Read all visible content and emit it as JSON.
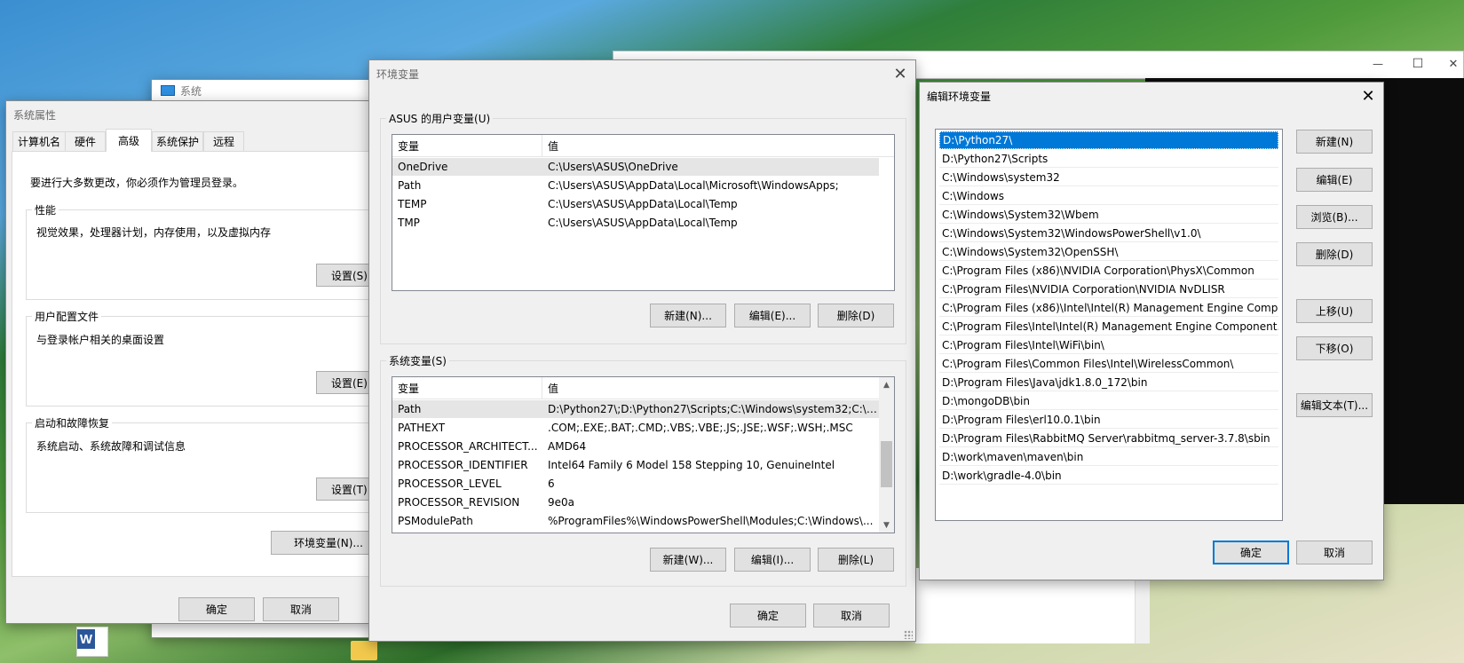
{
  "desktop": {
    "taskbar_icon": "word-icon"
  },
  "bg_window": {
    "controls": {
      "minimize": "—",
      "maximize": "☐",
      "close": "✕"
    }
  },
  "system_window": {
    "title": "系统"
  },
  "sys_props": {
    "title": "系统属性",
    "tabs": [
      "计算机名",
      "硬件",
      "高级",
      "系统保护",
      "远程"
    ],
    "active_tab": "高级",
    "admin_note": "要进行大多数更改，你必须作为管理员登录。",
    "perf": {
      "title": "性能",
      "desc": "视觉效果，处理器计划，内存使用，以及虚拟内存",
      "button": "设置(S)..."
    },
    "profile": {
      "title": "用户配置文件",
      "desc": "与登录帐户相关的桌面设置",
      "button": "设置(E)..."
    },
    "startup": {
      "title": "启动和故障恢复",
      "desc": "系统启动、系统故障和调试信息",
      "button": "设置(T)..."
    },
    "env_button": "环境变量(N)...",
    "ok": "确定",
    "cancel": "取消"
  },
  "env_dialog": {
    "title": "环境变量",
    "close": "✕",
    "user_group": "ASUS 的用户变量(U)",
    "columns": {
      "name": "变量",
      "value": "值"
    },
    "user_vars": [
      {
        "name": "OneDrive",
        "value": "C:\\Users\\ASUS\\OneDrive"
      },
      {
        "name": "Path",
        "value": "C:\\Users\\ASUS\\AppData\\Local\\Microsoft\\WindowsApps;"
      },
      {
        "name": "TEMP",
        "value": "C:\\Users\\ASUS\\AppData\\Local\\Temp"
      },
      {
        "name": "TMP",
        "value": "C:\\Users\\ASUS\\AppData\\Local\\Temp"
      }
    ],
    "user_buttons": {
      "new": "新建(N)...",
      "edit": "编辑(E)...",
      "delete": "删除(D)"
    },
    "sys_group": "系统变量(S)",
    "sys_vars": [
      {
        "name": "Path",
        "value": "D:\\Python27\\;D:\\Python27\\Scripts;C:\\Windows\\system32;C:\\Wi..."
      },
      {
        "name": "PATHEXT",
        "value": ".COM;.EXE;.BAT;.CMD;.VBS;.VBE;.JS;.JSE;.WSF;.WSH;.MSC"
      },
      {
        "name": "PROCESSOR_ARCHITECT...",
        "value": "AMD64"
      },
      {
        "name": "PROCESSOR_IDENTIFIER",
        "value": "Intel64 Family 6 Model 158 Stepping 10, GenuineIntel"
      },
      {
        "name": "PROCESSOR_LEVEL",
        "value": "6"
      },
      {
        "name": "PROCESSOR_REVISION",
        "value": "9e0a"
      },
      {
        "name": "PSModulePath",
        "value": "%ProgramFiles%\\WindowsPowerShell\\Modules;C:\\Windows\\..."
      }
    ],
    "sys_buttons": {
      "new": "新建(W)...",
      "edit": "编辑(I)...",
      "delete": "删除(L)"
    },
    "ok": "确定",
    "cancel": "取消"
  },
  "edit_dialog": {
    "title": "编辑环境变量",
    "close": "✕",
    "paths": [
      "D:\\Python27\\",
      "D:\\Python27\\Scripts",
      "C:\\Windows\\system32",
      "C:\\Windows",
      "C:\\Windows\\System32\\Wbem",
      "C:\\Windows\\System32\\WindowsPowerShell\\v1.0\\",
      "C:\\Windows\\System32\\OpenSSH\\",
      "C:\\Program Files (x86)\\NVIDIA Corporation\\PhysX\\Common",
      "C:\\Program Files\\NVIDIA Corporation\\NVIDIA NvDLISR",
      "C:\\Program Files (x86)\\Intel\\Intel(R) Management Engine Comp...",
      "C:\\Program Files\\Intel\\Intel(R) Management Engine Component...",
      "C:\\Program Files\\Intel\\WiFi\\bin\\",
      "C:\\Program Files\\Common Files\\Intel\\WirelessCommon\\",
      "D:\\Program Files\\Java\\jdk1.8.0_172\\bin",
      "D:\\mongoDB\\bin",
      "D:\\Program Files\\erl10.0.1\\bin",
      "D:\\Program Files\\RabbitMQ Server\\rabbitmq_server-3.7.8\\sbin",
      "D:\\work\\maven\\maven\\bin",
      "D:\\work\\gradle-4.0\\bin"
    ],
    "selected_index": 0,
    "buttons": {
      "new": "新建(N)",
      "edit": "编辑(E)",
      "browse": "浏览(B)...",
      "delete": "删除(D)",
      "up": "上移(U)",
      "down": "下移(O)",
      "edit_text": "编辑文本(T)..."
    },
    "ok": "确定",
    "cancel": "取消"
  }
}
